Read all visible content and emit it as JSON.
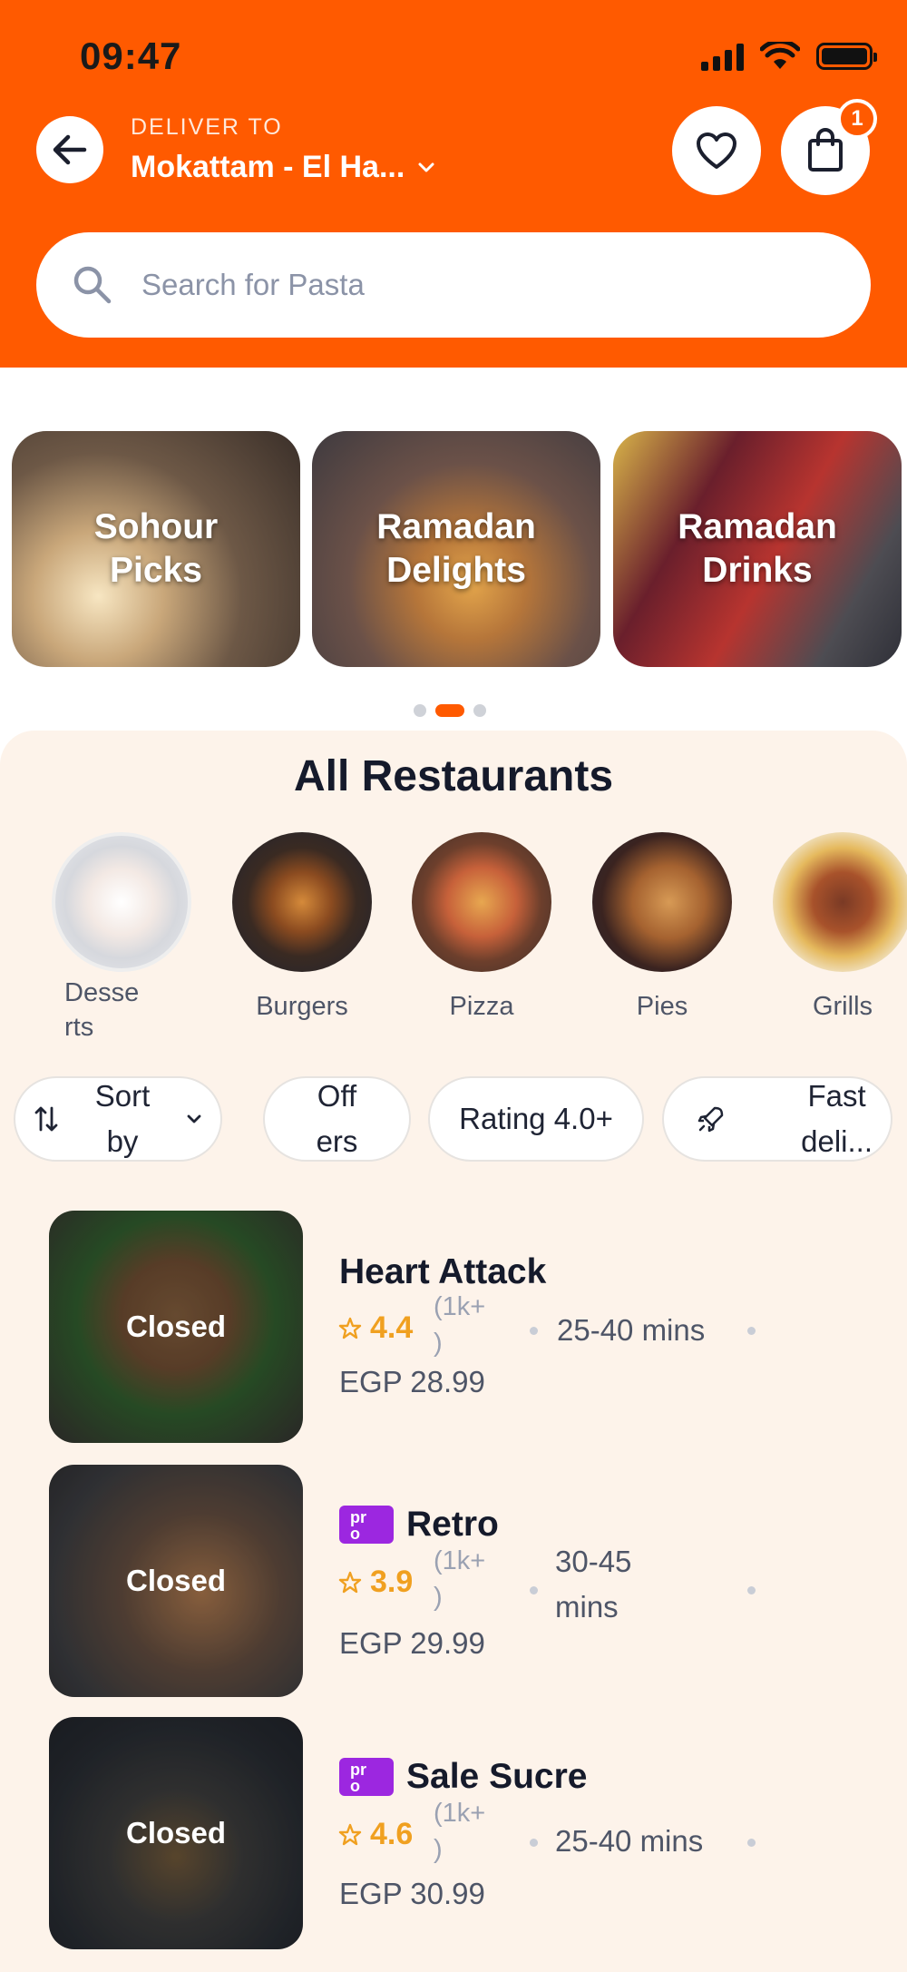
{
  "status_bar": {
    "time": "09:47"
  },
  "header": {
    "deliver_label": "DELIVER TO",
    "deliver_value": "Mokattam - El Ha...",
    "cart_count": "1"
  },
  "search": {
    "placeholder": "Search for Pasta"
  },
  "promos": [
    {
      "label": "Sohour Picks"
    },
    {
      "label": "Ramadan Delights"
    },
    {
      "label": "Ramadan Drinks"
    }
  ],
  "carousel": {
    "page_count": 3,
    "active_index": 1
  },
  "restaurants_section": {
    "title": "All Restaurants",
    "categories": [
      {
        "name": "Desse\nrts"
      },
      {
        "name": "Burgers"
      },
      {
        "name": "Pizza"
      },
      {
        "name": "Pies"
      },
      {
        "name": "Grills"
      }
    ],
    "filters": {
      "sort": "Sort\nby",
      "offers": "Off\ners",
      "rating": "Rating 4.0+",
      "fast": "Fast\ndeli..."
    },
    "items": [
      {
        "name": "Heart Attack",
        "status": "Closed",
        "rating": "4.4",
        "count": "(1k+\n)",
        "eta": "25-40 mins",
        "fee": "EGP 28.99",
        "pro": false
      },
      {
        "name": "Retro",
        "status": "Closed",
        "rating": "3.9",
        "count": "(1k+\n)",
        "eta": "30-45\nmins",
        "fee": "EGP 29.99",
        "pro": true,
        "pro_label": "pr\no"
      },
      {
        "name": "Sale Sucre",
        "status": "Closed",
        "rating": "4.6",
        "count": "(1k+\n)",
        "eta": "25-40 mins",
        "fee": "EGP 30.99",
        "pro": true,
        "pro_label": "pr\no"
      }
    ]
  },
  "colors": {
    "brand": "#ff5a00",
    "rating": "#f0a020",
    "pro": "#9c27e0"
  }
}
